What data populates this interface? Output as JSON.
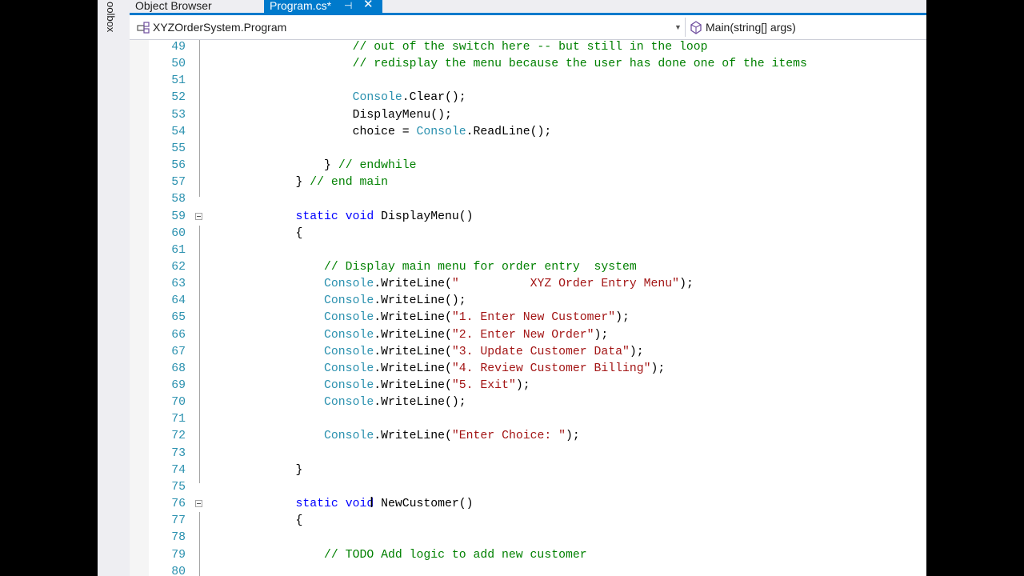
{
  "toolbox_label": "oolbox",
  "tabs": {
    "object_browser": "Object Browser",
    "program": "Program.cs*",
    "pin": "⊣",
    "close": "✕"
  },
  "nav": {
    "left": "XYZOrderSystem.Program",
    "right": "Main(string[] args)"
  },
  "colors": {
    "accent": "#007acc",
    "keyword": "#0000ff",
    "type": "#2b91af",
    "comment": "#008000",
    "string": "#a31515"
  },
  "code_lines": [
    {
      "n": "49",
      "indent": "            ",
      "parts": [
        {
          "t": "// out of the switch here -- but still in the loop",
          "c": "cm"
        }
      ]
    },
    {
      "n": "50",
      "indent": "            ",
      "parts": [
        {
          "t": "// redisplay the menu because the user has done one of the items",
          "c": "cm"
        }
      ]
    },
    {
      "n": "51",
      "indent": "",
      "parts": []
    },
    {
      "n": "52",
      "indent": "            ",
      "parts": [
        {
          "t": "Console",
          "c": "ty"
        },
        {
          "t": ".Clear();",
          "c": ""
        }
      ]
    },
    {
      "n": "53",
      "indent": "            ",
      "parts": [
        {
          "t": "DisplayMenu();",
          "c": ""
        }
      ]
    },
    {
      "n": "54",
      "indent": "            ",
      "parts": [
        {
          "t": "choice = ",
          "c": ""
        },
        {
          "t": "Console",
          "c": "ty"
        },
        {
          "t": ".ReadLine();",
          "c": ""
        }
      ]
    },
    {
      "n": "55",
      "indent": "",
      "parts": []
    },
    {
      "n": "56",
      "indent": "        ",
      "parts": [
        {
          "t": "} ",
          "c": ""
        },
        {
          "t": "// endwhile",
          "c": "cm"
        }
      ]
    },
    {
      "n": "57",
      "indent": "    ",
      "parts": [
        {
          "t": "} ",
          "c": ""
        },
        {
          "t": "// end main",
          "c": "cm"
        }
      ]
    },
    {
      "n": "58",
      "indent": "",
      "parts": []
    },
    {
      "n": "59",
      "indent": "    ",
      "fold": true,
      "parts": [
        {
          "t": "static",
          "c": "kw"
        },
        {
          "t": " ",
          "c": ""
        },
        {
          "t": "void",
          "c": "kw"
        },
        {
          "t": " DisplayMenu()",
          "c": ""
        }
      ]
    },
    {
      "n": "60",
      "indent": "    ",
      "parts": [
        {
          "t": "{",
          "c": ""
        }
      ]
    },
    {
      "n": "61",
      "indent": "",
      "parts": []
    },
    {
      "n": "62",
      "indent": "        ",
      "parts": [
        {
          "t": "// Display main menu for order entry  system",
          "c": "cm"
        }
      ]
    },
    {
      "n": "63",
      "indent": "        ",
      "parts": [
        {
          "t": "Console",
          "c": "ty"
        },
        {
          "t": ".WriteLine(",
          "c": ""
        },
        {
          "t": "\"          XYZ Order Entry Menu\"",
          "c": "st"
        },
        {
          "t": ");",
          "c": ""
        }
      ]
    },
    {
      "n": "64",
      "indent": "        ",
      "parts": [
        {
          "t": "Console",
          "c": "ty"
        },
        {
          "t": ".WriteLine();",
          "c": ""
        }
      ]
    },
    {
      "n": "65",
      "indent": "        ",
      "parts": [
        {
          "t": "Console",
          "c": "ty"
        },
        {
          "t": ".WriteLine(",
          "c": ""
        },
        {
          "t": "\"1. Enter New Customer\"",
          "c": "st"
        },
        {
          "t": ");",
          "c": ""
        }
      ]
    },
    {
      "n": "66",
      "indent": "        ",
      "parts": [
        {
          "t": "Console",
          "c": "ty"
        },
        {
          "t": ".WriteLine(",
          "c": ""
        },
        {
          "t": "\"2. Enter New Order\"",
          "c": "st"
        },
        {
          "t": ");",
          "c": ""
        }
      ]
    },
    {
      "n": "67",
      "indent": "        ",
      "parts": [
        {
          "t": "Console",
          "c": "ty"
        },
        {
          "t": ".WriteLine(",
          "c": ""
        },
        {
          "t": "\"3. Update Customer Data\"",
          "c": "st"
        },
        {
          "t": ");",
          "c": ""
        }
      ]
    },
    {
      "n": "68",
      "indent": "        ",
      "parts": [
        {
          "t": "Console",
          "c": "ty"
        },
        {
          "t": ".WriteLine(",
          "c": ""
        },
        {
          "t": "\"4. Review Customer Billing\"",
          "c": "st"
        },
        {
          "t": ");",
          "c": ""
        }
      ]
    },
    {
      "n": "69",
      "indent": "        ",
      "parts": [
        {
          "t": "Console",
          "c": "ty"
        },
        {
          "t": ".WriteLine(",
          "c": ""
        },
        {
          "t": "\"5. Exit\"",
          "c": "st"
        },
        {
          "t": ");",
          "c": ""
        }
      ]
    },
    {
      "n": "70",
      "indent": "        ",
      "parts": [
        {
          "t": "Console",
          "c": "ty"
        },
        {
          "t": ".WriteLine();",
          "c": ""
        }
      ]
    },
    {
      "n": "71",
      "indent": "",
      "parts": []
    },
    {
      "n": "72",
      "indent": "        ",
      "parts": [
        {
          "t": "Console",
          "c": "ty"
        },
        {
          "t": ".WriteLine(",
          "c": ""
        },
        {
          "t": "\"Enter Choice: \"",
          "c": "st"
        },
        {
          "t": ");",
          "c": ""
        }
      ]
    },
    {
      "n": "73",
      "indent": "",
      "parts": []
    },
    {
      "n": "74",
      "indent": "    ",
      "parts": [
        {
          "t": "}",
          "c": ""
        }
      ]
    },
    {
      "n": "75",
      "indent": "",
      "parts": []
    },
    {
      "n": "76",
      "indent": "    ",
      "fold": true,
      "parts": [
        {
          "t": "static",
          "c": "kw"
        },
        {
          "t": " ",
          "c": ""
        },
        {
          "t": "void",
          "c": "kw"
        },
        {
          "t": " NewCustomer()",
          "c": ""
        }
      ]
    },
    {
      "n": "77",
      "indent": "    ",
      "parts": [
        {
          "t": "{",
          "c": ""
        }
      ]
    },
    {
      "n": "78",
      "indent": "",
      "parts": []
    },
    {
      "n": "79",
      "indent": "        ",
      "parts": [
        {
          "t": "// TODO Add logic to add new customer",
          "c": "cm"
        }
      ]
    },
    {
      "n": "80",
      "indent": "",
      "parts": []
    }
  ]
}
